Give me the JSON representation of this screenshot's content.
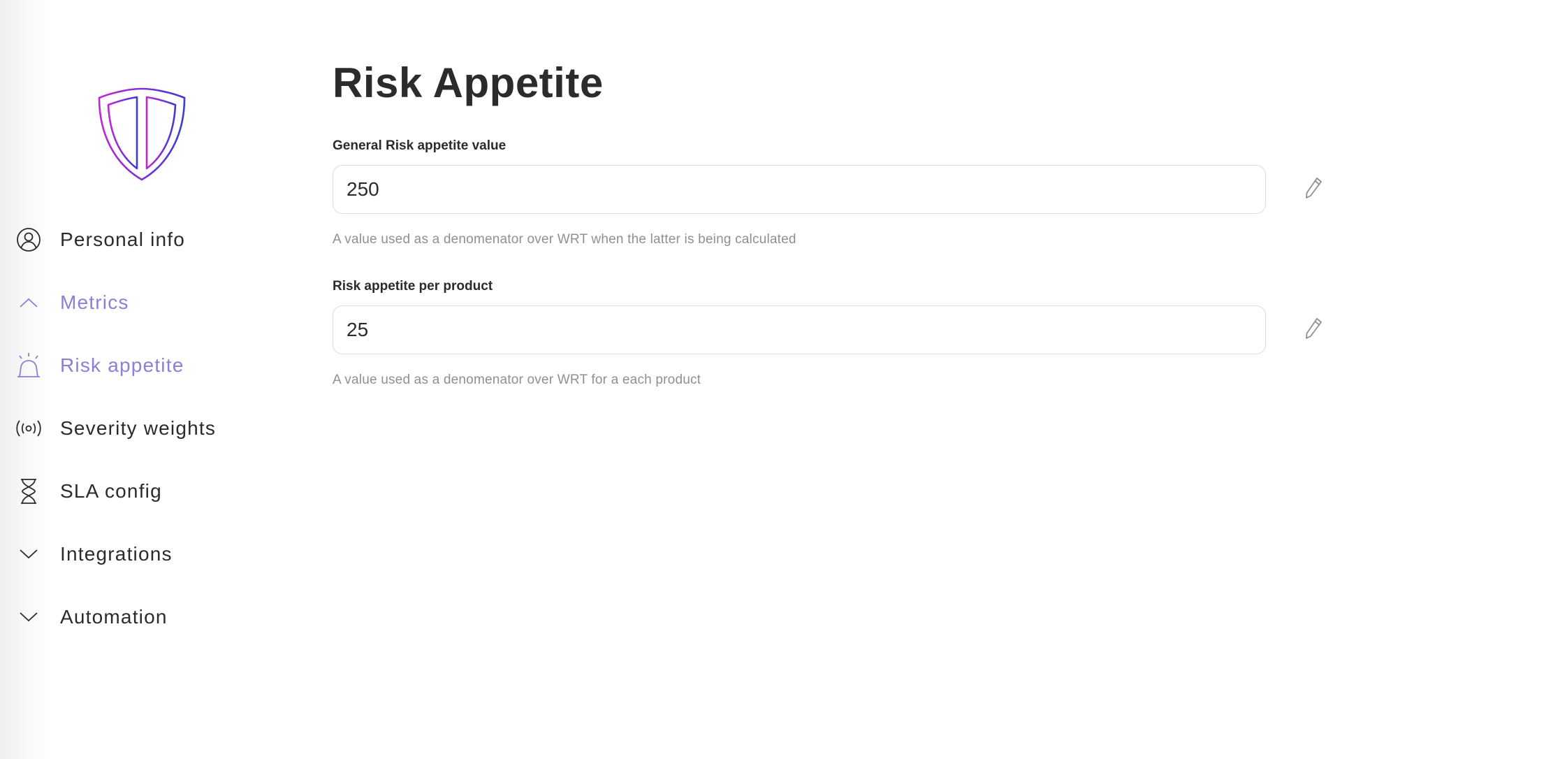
{
  "colors": {
    "accent": "#8a80d8",
    "logo_gradient_start": "#c026d3",
    "logo_gradient_end": "#3b3bd6",
    "text": "#2b2b2b",
    "muted": "#8f8f94",
    "border": "#dcdcdc"
  },
  "sidebar": {
    "logo_icon": "shield-icon",
    "items": [
      {
        "label": "Personal info",
        "icon": "user-circle-icon",
        "active": false
      },
      {
        "label": "Metrics",
        "icon": "chevron-up-icon",
        "active": true
      },
      {
        "label": "Risk appetite",
        "icon": "alarm-bell-icon",
        "active": true
      },
      {
        "label": "Severity weights",
        "icon": "broadcast-icon",
        "active": false
      },
      {
        "label": "SLA config",
        "icon": "hourglass-icon",
        "active": false
      },
      {
        "label": "Integrations",
        "icon": "chevron-down-icon",
        "active": false
      },
      {
        "label": "Automation",
        "icon": "chevron-down-icon",
        "active": false
      }
    ]
  },
  "main": {
    "title": "Risk Appetite",
    "fields": [
      {
        "label": "General Risk appetite value",
        "value": "250",
        "help": "A value used as a denomenator over WRT when the latter is being calculated",
        "edit_icon": "pencil-icon"
      },
      {
        "label": "Risk appetite per product",
        "value": "25",
        "help": "A value used as a denomenator over WRT for a each product",
        "edit_icon": "pencil-icon"
      }
    ]
  }
}
